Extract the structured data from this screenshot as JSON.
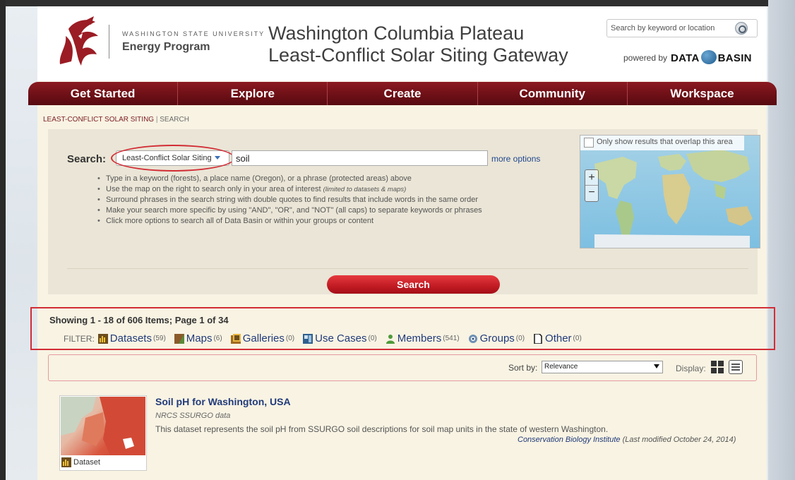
{
  "header": {
    "university_small": "WASHINGTON STATE UNIVERSITY",
    "program": "Energy Program",
    "title_line1": "Washington Columbia Plateau",
    "title_line2": "Least-Conflict Solar Siting Gateway",
    "search_placeholder": "Search by keyword or location",
    "powered_by": "powered by",
    "databasin_left": "DATA",
    "databasin_right": "BASIN",
    "brand_color": "#7b1c22"
  },
  "nav": {
    "items": [
      "Get Started",
      "Explore",
      "Create",
      "Community",
      "Workspace"
    ]
  },
  "breadcrumb": {
    "section": "LEAST-CONFLICT SOLAR SITING",
    "separator": "|",
    "current": "SEARCH"
  },
  "search": {
    "label": "Search:",
    "scope": "Least-Conflict Solar Siting",
    "query": "soil",
    "more_options": "more options",
    "tips": [
      "Type in a keyword (forests), a place name (Oregon), or a phrase (protected areas) above",
      "Use the map on the right to search only in your area of interest",
      "Surround phrases in the search string with double quotes to find results that include words in the same order",
      "Make your search more specific by using \"AND\", \"OR\", and \"NOT\" (all caps) to separate keywords or phrases",
      "Click more options to search all of Data Basin or within your groups or content"
    ],
    "tip2_note": "(limited to datasets & maps)",
    "map_overlap_label": "Only show results that overlap this area",
    "zoom_in": "+",
    "zoom_out": "−",
    "button": "Search"
  },
  "results": {
    "showing": "Showing 1 - 18 of 606 Items; Page 1 of 34",
    "filter_label": "FILTER:",
    "filters": [
      {
        "label": "Datasets",
        "count": "(59)",
        "icon": "dataset-icon"
      },
      {
        "label": "Maps",
        "count": "(6)",
        "icon": "map-icon"
      },
      {
        "label": "Galleries",
        "count": "(0)",
        "icon": "gallery-icon"
      },
      {
        "label": "Use Cases",
        "count": "(0)",
        "icon": "use-case-icon"
      },
      {
        "label": "Members",
        "count": "(541)",
        "icon": "member-icon"
      },
      {
        "label": "Groups",
        "count": "(0)",
        "icon": "group-icon"
      },
      {
        "label": "Other",
        "count": "(0)",
        "icon": "document-icon"
      }
    ],
    "sort_label": "Sort by:",
    "sort_value": "Relevance",
    "display_label": "Display:"
  },
  "items": [
    {
      "title": "Soil pH for Washington, USA",
      "source": "NRCS SSURGO data",
      "description": "This dataset represents the soil pH from SSURGO soil descriptions for soil map units in the state of western Washington.",
      "organization": "Conservation Biology Institute",
      "modified": "(Last modified October 24, 2014)",
      "type": "Dataset"
    }
  ]
}
